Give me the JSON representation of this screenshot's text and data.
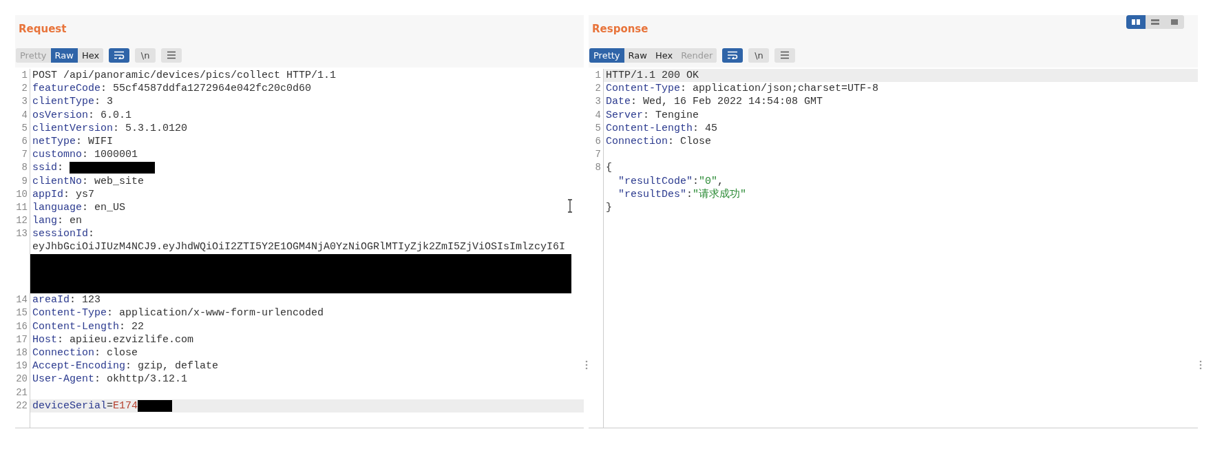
{
  "layout_buttons": [
    {
      "kind": "columns",
      "selected": true
    },
    {
      "kind": "rows",
      "selected": false
    },
    {
      "kind": "single",
      "selected": false
    }
  ],
  "request": {
    "title": "Request",
    "view_tabs": [
      {
        "label": "Pretty",
        "selected": false,
        "disabled": true
      },
      {
        "label": "Raw",
        "selected": true,
        "disabled": false
      },
      {
        "label": "Hex",
        "selected": false,
        "disabled": false
      }
    ],
    "tool_buttons": [
      {
        "kind": "wrap",
        "selected": true
      },
      {
        "kind": "text",
        "label": "\\n",
        "selected": false
      },
      {
        "kind": "menu",
        "selected": false
      }
    ],
    "lines": [
      {
        "number": "1",
        "highlighted": false,
        "segments": [
          {
            "kind": "plain",
            "text": "POST /api/panoramic/devices/pics/collect HTTP/1.1"
          }
        ]
      },
      {
        "number": "2",
        "highlighted": false,
        "segments": [
          {
            "kind": "name",
            "text": "featureCode"
          },
          {
            "kind": "plain",
            "text": ": 55cf4587ddfa1272964e042fc20c0d60"
          }
        ]
      },
      {
        "number": "3",
        "highlighted": false,
        "segments": [
          {
            "kind": "name",
            "text": "clientType"
          },
          {
            "kind": "plain",
            "text": ": 3"
          }
        ]
      },
      {
        "number": "4",
        "highlighted": false,
        "segments": [
          {
            "kind": "name",
            "text": "osVersion"
          },
          {
            "kind": "plain",
            "text": ": 6.0.1"
          }
        ]
      },
      {
        "number": "5",
        "highlighted": false,
        "segments": [
          {
            "kind": "name",
            "text": "clientVersion"
          },
          {
            "kind": "plain",
            "text": ": 5.3.1.0120"
          }
        ]
      },
      {
        "number": "6",
        "highlighted": false,
        "segments": [
          {
            "kind": "name",
            "text": "netType"
          },
          {
            "kind": "plain",
            "text": ": WIFI"
          }
        ]
      },
      {
        "number": "7",
        "highlighted": false,
        "segments": [
          {
            "kind": "name",
            "text": "customno"
          },
          {
            "kind": "plain",
            "text": ": 1000001"
          }
        ]
      },
      {
        "number": "8",
        "highlighted": false,
        "segments": [
          {
            "kind": "name",
            "text": "ssid"
          },
          {
            "kind": "plain",
            "text": ": "
          },
          {
            "kind": "redacted"
          }
        ]
      },
      {
        "number": "9",
        "highlighted": false,
        "segments": [
          {
            "kind": "name",
            "text": "clientNo"
          },
          {
            "kind": "plain",
            "text": ": web_site"
          }
        ]
      },
      {
        "number": "10",
        "highlighted": false,
        "segments": [
          {
            "kind": "name",
            "text": "appId"
          },
          {
            "kind": "plain",
            "text": ": ys7"
          }
        ]
      },
      {
        "number": "11",
        "highlighted": false,
        "segments": [
          {
            "kind": "name",
            "text": "language"
          },
          {
            "kind": "plain",
            "text": ": en_US"
          }
        ]
      },
      {
        "number": "12",
        "highlighted": false,
        "segments": [
          {
            "kind": "name",
            "text": "lang"
          },
          {
            "kind": "plain",
            "text": ": en"
          }
        ]
      },
      {
        "number": "13",
        "highlighted": false,
        "segments": [
          {
            "kind": "name",
            "text": "sessionId"
          },
          {
            "kind": "plain",
            "text": ":"
          }
        ]
      },
      {
        "highlighted": false,
        "segments": [
          {
            "kind": "plain",
            "text": "eyJhbGciOiJIUzM4NCJ9.eyJhdWQiOiI2ZTI5Y2E1OGM4NjA0YzNiOGRlMTIyZjk2ZmI5ZjViOSIsImlzcyI6I"
          }
        ]
      },
      {
        "segments": [
          {
            "kind": "redacted_block"
          }
        ]
      },
      {
        "number": "14",
        "highlighted": false,
        "segments": [
          {
            "kind": "name",
            "text": "areaId"
          },
          {
            "kind": "plain",
            "text": ": 123"
          }
        ]
      },
      {
        "number": "15",
        "highlighted": false,
        "segments": [
          {
            "kind": "name",
            "text": "Content-Type"
          },
          {
            "kind": "plain",
            "text": ": application/x-www-form-urlencoded"
          }
        ]
      },
      {
        "number": "16",
        "highlighted": false,
        "segments": [
          {
            "kind": "name",
            "text": "Content-Length"
          },
          {
            "kind": "plain",
            "text": ": 22"
          }
        ]
      },
      {
        "number": "17",
        "highlighted": false,
        "segments": [
          {
            "kind": "name",
            "text": "Host"
          },
          {
            "kind": "plain",
            "text": ": apiieu.ezvizlife.com"
          }
        ]
      },
      {
        "number": "18",
        "highlighted": false,
        "segments": [
          {
            "kind": "name",
            "text": "Connection"
          },
          {
            "kind": "plain",
            "text": ": close"
          }
        ]
      },
      {
        "number": "19",
        "highlighted": false,
        "segments": [
          {
            "kind": "name",
            "text": "Accept-Encoding"
          },
          {
            "kind": "plain",
            "text": ": gzip, deflate"
          }
        ]
      },
      {
        "number": "20",
        "highlighted": false,
        "segments": [
          {
            "kind": "name",
            "text": "User-Agent"
          },
          {
            "kind": "plain",
            "text": ": okhttp/3.12.1"
          }
        ]
      },
      {
        "number": "21",
        "highlighted": false
      },
      {
        "number": "22",
        "highlighted": true,
        "segments": [
          {
            "kind": "name",
            "text": "deviceSerial"
          },
          {
            "kind": "plain",
            "text": "="
          },
          {
            "kind": "param_value",
            "text": "E174"
          },
          {
            "kind": "redacted"
          }
        ]
      }
    ]
  },
  "response": {
    "title": "Response",
    "view_tabs": [
      {
        "label": "Pretty",
        "selected": true,
        "disabled": false
      },
      {
        "label": "Raw",
        "selected": false,
        "disabled": false
      },
      {
        "label": "Hex",
        "selected": false,
        "disabled": false
      },
      {
        "label": "Render",
        "selected": false,
        "disabled": true
      }
    ],
    "tool_buttons": [
      {
        "kind": "wrap",
        "selected": true
      },
      {
        "kind": "text",
        "label": "\\n",
        "selected": false
      },
      {
        "kind": "menu",
        "selected": false
      }
    ],
    "lines": [
      {
        "number": "1",
        "highlighted": true,
        "segments": [
          {
            "kind": "plain",
            "text": "HTTP/1.1 200 OK"
          }
        ]
      },
      {
        "number": "2",
        "highlighted": false,
        "segments": [
          {
            "kind": "name",
            "text": "Content-Type"
          },
          {
            "kind": "plain",
            "text": ": application/json;charset=UTF-8"
          }
        ]
      },
      {
        "number": "3",
        "highlighted": false,
        "segments": [
          {
            "kind": "name",
            "text": "Date"
          },
          {
            "kind": "plain",
            "text": ": Wed, 16 Feb 2022 14:54:08 GMT"
          }
        ]
      },
      {
        "number": "4",
        "highlighted": false,
        "segments": [
          {
            "kind": "name",
            "text": "Server"
          },
          {
            "kind": "plain",
            "text": ": Tengine"
          }
        ]
      },
      {
        "number": "5",
        "highlighted": false,
        "segments": [
          {
            "kind": "name",
            "text": "Content-Length"
          },
          {
            "kind": "plain",
            "text": ": 45"
          }
        ]
      },
      {
        "number": "6",
        "highlighted": false,
        "segments": [
          {
            "kind": "name",
            "text": "Connection"
          },
          {
            "kind": "plain",
            "text": ": Close"
          }
        ]
      },
      {
        "number": "7",
        "highlighted": false
      },
      {
        "number": "8",
        "highlighted": false,
        "segments": [
          {
            "kind": "plain",
            "text": "{"
          }
        ],
        "children": [
          {
            "highlighted": false,
            "segments": [
              {
                "kind": "name",
                "text": "\"resultCode\""
              },
              {
                "kind": "plain",
                "text": ":"
              },
              {
                "kind": "string",
                "text": "\"0\""
              },
              {
                "kind": "plain",
                "text": ","
              }
            ]
          },
          {
            "highlighted": false,
            "segments": [
              {
                "kind": "name",
                "text": "\"resultDes\""
              },
              {
                "kind": "plain",
                "text": ":"
              },
              {
                "kind": "string",
                "text": "\"请求成功\""
              }
            ]
          }
        ]
      },
      {
        "highlighted": false,
        "segments": [
          {
            "kind": "plain",
            "text": "}"
          }
        ]
      }
    ]
  }
}
